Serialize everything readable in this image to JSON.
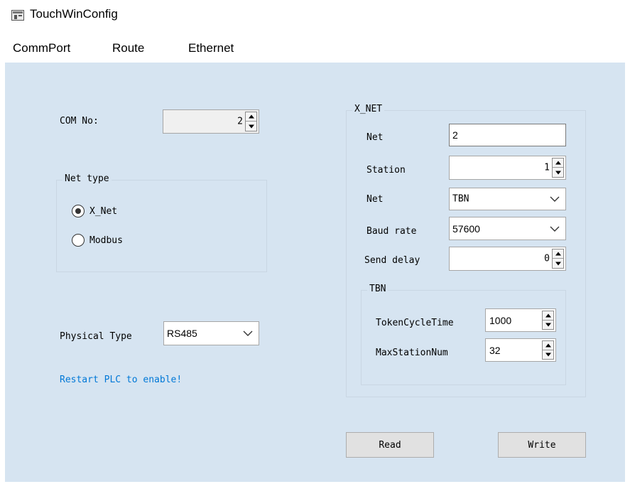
{
  "window": {
    "title": "TouchWinConfig",
    "icon": "app-icon"
  },
  "menu": {
    "items": [
      "CommPort",
      "Route",
      "Ethernet"
    ]
  },
  "left": {
    "com_label": "COM No:",
    "com_value": "2",
    "net_type_label": "Net type",
    "radios": [
      {
        "label": "X_Net",
        "selected": true
      },
      {
        "label": "Modbus",
        "selected": false
      }
    ],
    "physical_label": "Physical Type",
    "physical_value": "RS485",
    "restart_note": "Restart PLC to enable!",
    "note_color": "#0078d7"
  },
  "xnet": {
    "group_label": "X_NET",
    "net_label": "Net",
    "net_value": "2",
    "station_label": "Station",
    "station_value": "1",
    "net2_label": "Net",
    "net2_value": "TBN",
    "baud_label": "Baud rate",
    "baud_value": "57600",
    "delay_label": "Send delay",
    "delay_value": "0",
    "tbn": {
      "group_label": "TBN",
      "token_label": "TokenCycleTime",
      "token_value": "1000",
      "maxsta_label": "MaxStationNum",
      "maxsta_value": "32"
    }
  },
  "buttons": {
    "read": "Read",
    "write": "Write"
  },
  "colors": {
    "panel_bg": "#d6e4f1",
    "accent": "#0078d7"
  }
}
